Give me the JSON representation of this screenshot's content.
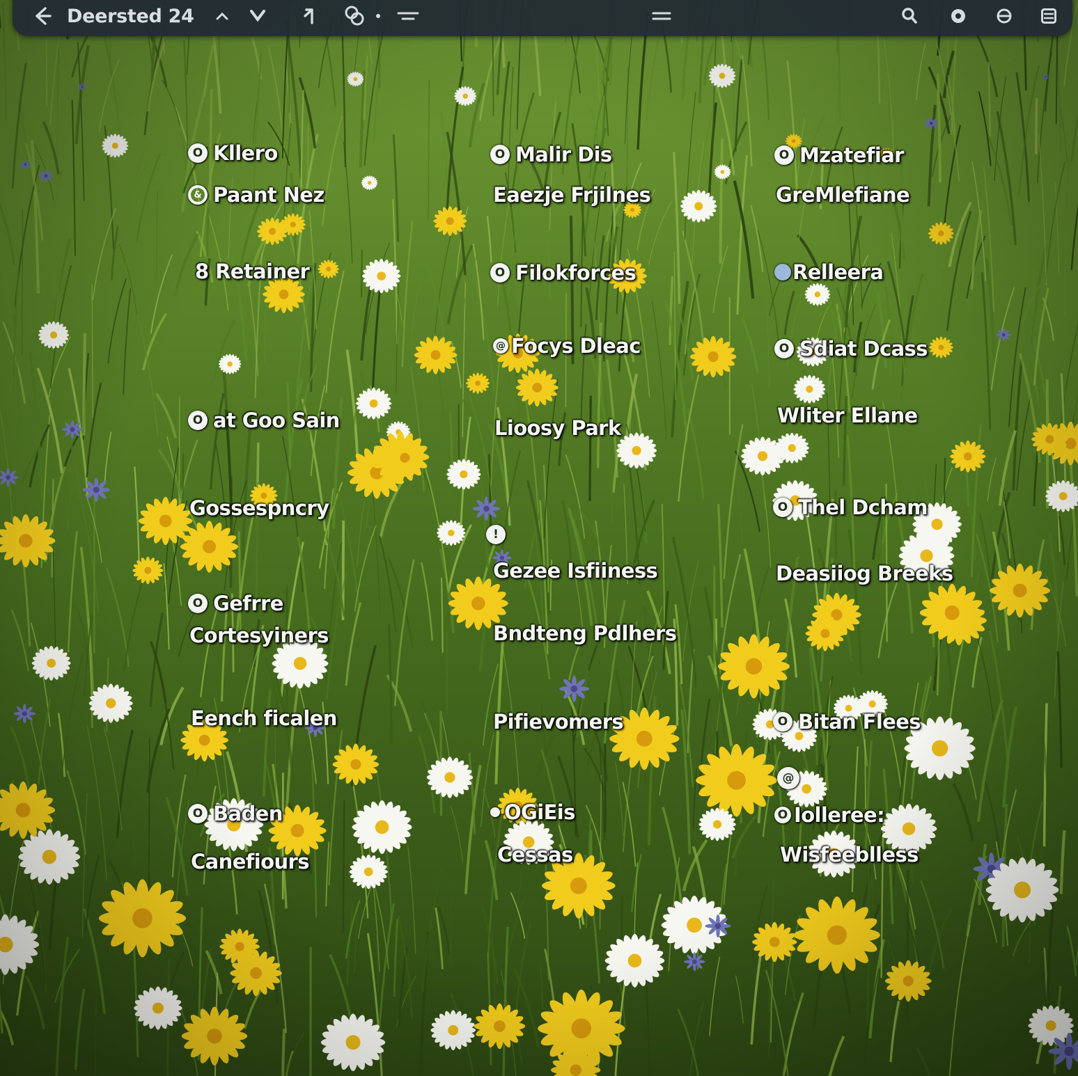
{
  "topbar": {
    "title": "Deersted 24",
    "icons": {
      "back": "back-arrow-icon",
      "up": "chevron-up-icon",
      "down": "chevron-down-icon",
      "forward": "corner-arrow-icon",
      "link": "link-icon",
      "menu": "lines-icon",
      "handle": "drag-handle-icon",
      "search": "search-icon",
      "record": "record-icon",
      "settings": "gear-icon",
      "list": "list-icon"
    }
  },
  "desktop": {
    "columns": [
      {
        "items": [
          {
            "glyph": "O",
            "label": "Kllero"
          },
          {
            "glyph": "&",
            "label": "Paant Nez"
          },
          {
            "glyph": "",
            "label": "8 Retainer"
          },
          {
            "glyph": "O",
            "label": "at Goo Sain"
          },
          {
            "glyph": "",
            "label": "Gossespncry"
          },
          {
            "glyph": "O",
            "label": "Gefrre"
          },
          {
            "glyph": "",
            "label": "Cortesyiners"
          },
          {
            "glyph": "",
            "label": "Eench ficalen"
          },
          {
            "glyph": "O",
            "label": "Baden"
          },
          {
            "glyph": "",
            "label": "Canefiours"
          }
        ]
      },
      {
        "items": [
          {
            "glyph": "O",
            "label": "Malir Dis"
          },
          {
            "glyph": "",
            "label": "Eaezje Frjilnes"
          },
          {
            "glyph": "O",
            "label": "Filokforces"
          },
          {
            "glyph": "@",
            "label": "Focys Dleac"
          },
          {
            "glyph": "",
            "label": "Lioosy Park"
          },
          {
            "glyph": "!",
            "label": ""
          },
          {
            "glyph": "",
            "label": "Gezee Isfiiness"
          },
          {
            "glyph": "",
            "label": "Bndteng Pdlhers"
          },
          {
            "glyph": "",
            "label": "Pifievomers"
          },
          {
            "glyph": "",
            "label": "OGiEis"
          },
          {
            "glyph": "",
            "label": "Cessas"
          }
        ]
      },
      {
        "items": [
          {
            "glyph": "O",
            "label": "Mzatefiar"
          },
          {
            "glyph": "",
            "label": "GreMlefiane"
          },
          {
            "glyph": "",
            "label": "Relleera"
          },
          {
            "glyph": "O",
            "label": "Sdiat Dcass"
          },
          {
            "glyph": "",
            "label": "Wliter Ellane"
          },
          {
            "glyph": "O",
            "label": "Thel Dcham"
          },
          {
            "glyph": "",
            "label": "Deasiiog Breeks"
          },
          {
            "glyph": "O",
            "label": "Bitan Flees"
          },
          {
            "glyph": "@",
            "label": ""
          },
          {
            "glyph": "O",
            "label": "Iolleree:"
          },
          {
            "glyph": "",
            "label": "Wisfeeblless"
          }
        ]
      }
    ]
  },
  "colors": {
    "topbar_bg": "#222a34",
    "label_text": "#f4f6f2",
    "grass_dark": "#2c4512",
    "grass_mid": "#4f7a22",
    "grass_light": "#7fa83a",
    "daisy_yellow": "#f2cc1c",
    "daisy_white": "#f7f7f2",
    "cornflower": "#6f74b8"
  }
}
